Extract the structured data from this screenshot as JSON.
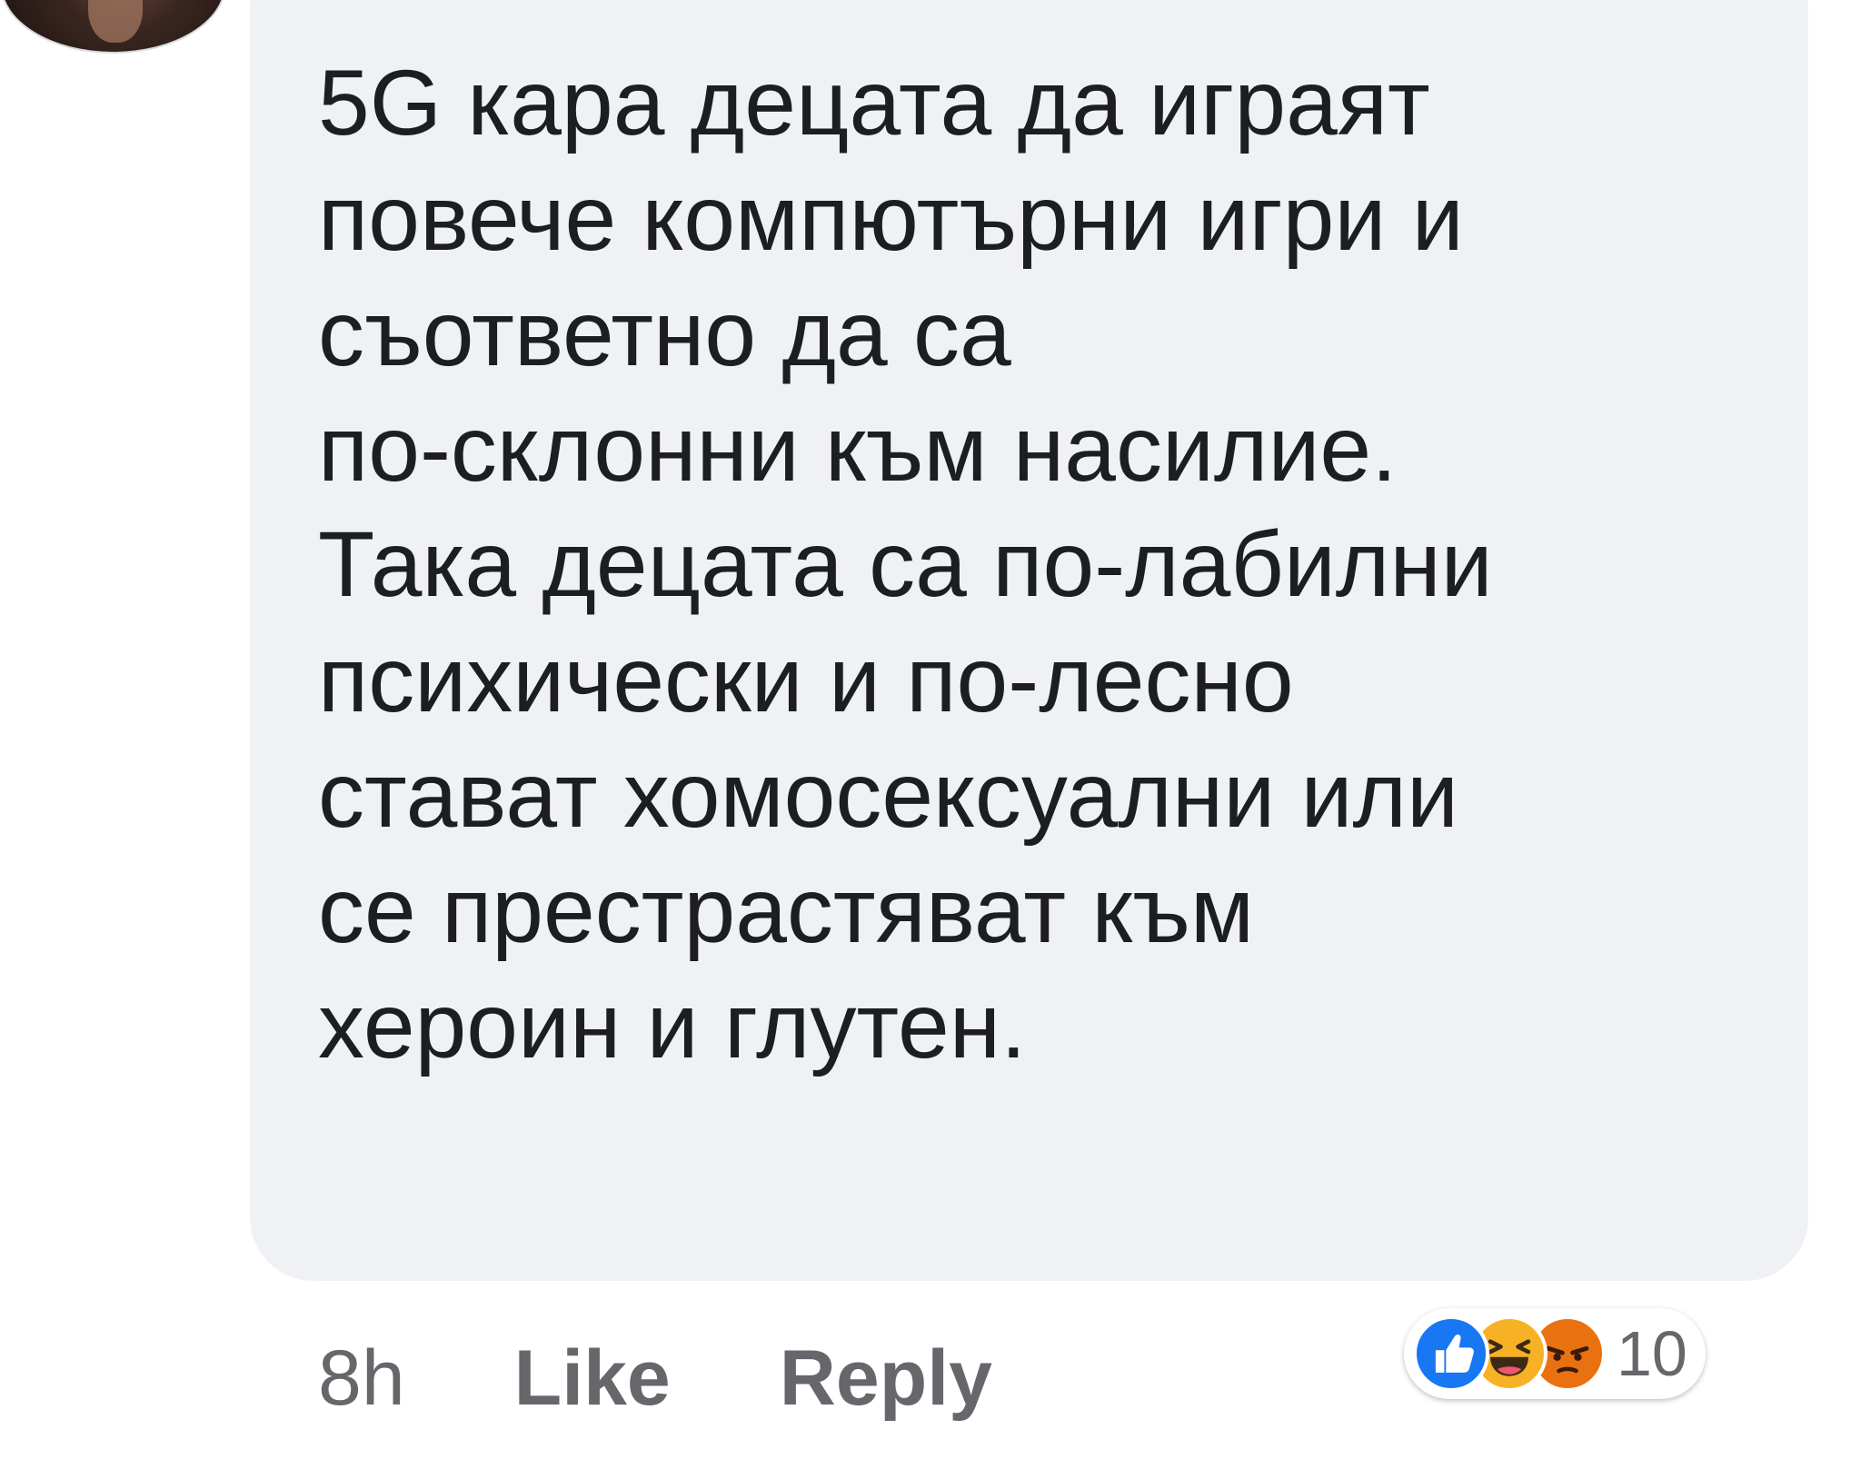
{
  "comment": {
    "text_lines": [
      "5G кара децата да играят",
      "повече компютърни игри и",
      "съответно да са",
      "по-склонни към насилие.",
      "Така децата са по-лабилни",
      "психически и по-лесно",
      "стават хомосексуални или",
      "се престрастяват към",
      "хероин и глутен."
    ]
  },
  "actions": {
    "time": "8h",
    "like_label": "Like",
    "reply_label": "Reply"
  },
  "reactions": {
    "icons": [
      "like-icon",
      "haha-icon",
      "angry-icon"
    ],
    "count": "10"
  },
  "colors": {
    "bubble": "#f0f1f4",
    "text": "#1c1e21",
    "meta": "#65676b",
    "like_blue": "#1877f2",
    "haha_yellow": "#f7b125",
    "angry_orange": "#e9710f"
  }
}
